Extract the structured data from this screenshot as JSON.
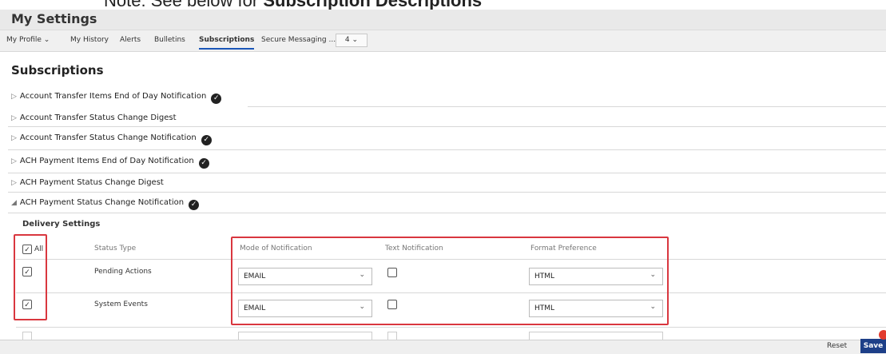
{
  "note": {
    "prefix": "Note: See below for ",
    "bold": "Subscription Descriptions"
  },
  "header": {
    "title": "My Settings"
  },
  "tabs": [
    {
      "label": "My Profile ⌄"
    },
    {
      "label": "My History"
    },
    {
      "label": "Alerts"
    },
    {
      "label": "Bulletins"
    },
    {
      "label": "Subscriptions"
    },
    {
      "label": "Secure Messaging ..."
    },
    {
      "label": "4 ⌄"
    }
  ],
  "page": {
    "title": "Subscriptions"
  },
  "subscriptions": [
    {
      "name": "Account Transfer Items End of Day Notification",
      "subscribed": true,
      "expanded": false
    },
    {
      "name": "Account Transfer Status Change Digest",
      "subscribed": false,
      "expanded": false
    },
    {
      "name": "Account Transfer Status Change Notification",
      "subscribed": true,
      "expanded": false
    },
    {
      "name": "ACH Payment Items End of Day Notification",
      "subscribed": true,
      "expanded": false
    },
    {
      "name": "ACH Payment Status Change Digest",
      "subscribed": false,
      "expanded": false
    },
    {
      "name": "ACH Payment Status Change Notification",
      "subscribed": true,
      "expanded": true
    }
  ],
  "delivery": {
    "title": "Delivery Settings",
    "all_label": "All",
    "all_checked": true,
    "columns": [
      "Status Type",
      "Mode of Notification",
      "Text Notification",
      "Format Preference"
    ],
    "rows": [
      {
        "status": "Pending Actions",
        "checked": true,
        "mode": "EMAIL",
        "text": false,
        "format": "HTML"
      },
      {
        "status": "System Events",
        "checked": true,
        "mode": "EMAIL",
        "text": false,
        "format": "HTML"
      }
    ]
  },
  "footer": {
    "reset_label": "Reset",
    "save_label": "Save"
  },
  "colors": {
    "accent": "#1d3f88",
    "highlight": "#d9373f",
    "tab_underline": "#1a56b8"
  }
}
